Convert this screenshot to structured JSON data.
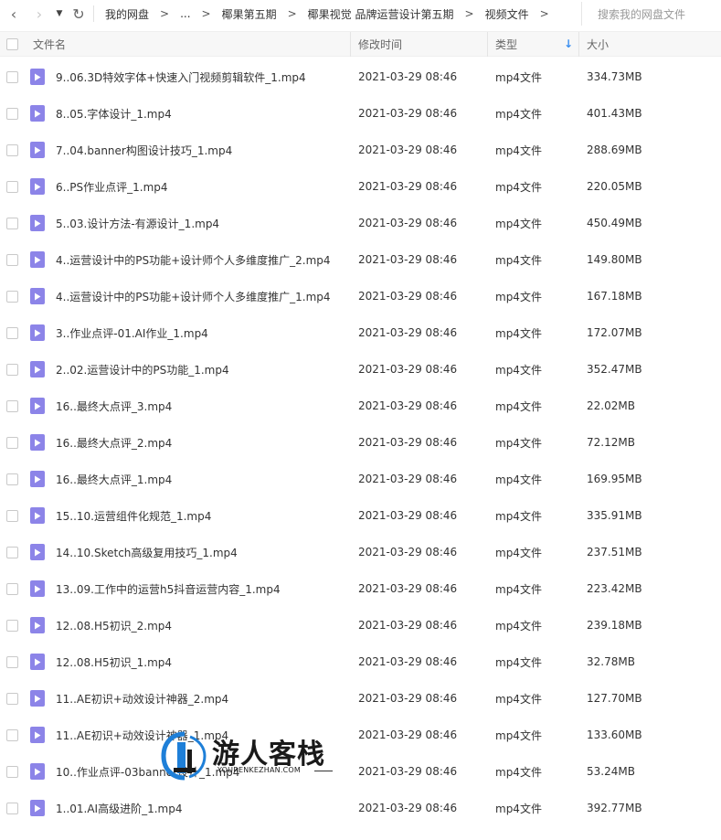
{
  "nav": {
    "back_icon": "chevron-left-icon",
    "forward_icon": "chevron-right-icon",
    "dropdown_icon": "caret-down-icon",
    "refresh_icon": "refresh-icon",
    "back_glyph": "‹",
    "forward_glyph": "›",
    "dropdown_glyph": "▼",
    "refresh_glyph": "↻"
  },
  "breadcrumb": {
    "items": [
      "我的网盘",
      "...",
      "椰果第五期",
      "椰果视觉 品牌运营设计第五期",
      "视频文件"
    ],
    "separator": ">"
  },
  "search": {
    "placeholder": "搜索我的网盘文件"
  },
  "columns": {
    "name": "文件名",
    "modified": "修改时间",
    "type": "类型",
    "size": "大小",
    "sort_indicator": "↓"
  },
  "files": [
    {
      "name": "9..06.3D特效字体+快速入门视频剪辑软件_1.mp4",
      "modified": "2021-03-29 08:46",
      "type": "mp4文件",
      "size": "334.73MB"
    },
    {
      "name": "8..05.字体设计_1.mp4",
      "modified": "2021-03-29 08:46",
      "type": "mp4文件",
      "size": "401.43MB"
    },
    {
      "name": "7..04.banner构图设计技巧_1.mp4",
      "modified": "2021-03-29 08:46",
      "type": "mp4文件",
      "size": "288.69MB"
    },
    {
      "name": "6..PS作业点评_1.mp4",
      "modified": "2021-03-29 08:46",
      "type": "mp4文件",
      "size": "220.05MB"
    },
    {
      "name": "5..03.设计方法-有源设计_1.mp4",
      "modified": "2021-03-29 08:46",
      "type": "mp4文件",
      "size": "450.49MB"
    },
    {
      "name": "4..运营设计中的PS功能+设计师个人多维度推广_2.mp4",
      "modified": "2021-03-29 08:46",
      "type": "mp4文件",
      "size": "149.80MB"
    },
    {
      "name": "4..运营设计中的PS功能+设计师个人多维度推广_1.mp4",
      "modified": "2021-03-29 08:46",
      "type": "mp4文件",
      "size": "167.18MB"
    },
    {
      "name": "3..作业点评-01.AI作业_1.mp4",
      "modified": "2021-03-29 08:46",
      "type": "mp4文件",
      "size": "172.07MB"
    },
    {
      "name": "2..02.运营设计中的PS功能_1.mp4",
      "modified": "2021-03-29 08:46",
      "type": "mp4文件",
      "size": "352.47MB"
    },
    {
      "name": "16..最终大点评_3.mp4",
      "modified": "2021-03-29 08:46",
      "type": "mp4文件",
      "size": "22.02MB"
    },
    {
      "name": "16..最终大点评_2.mp4",
      "modified": "2021-03-29 08:46",
      "type": "mp4文件",
      "size": "72.12MB"
    },
    {
      "name": "16..最终大点评_1.mp4",
      "modified": "2021-03-29 08:46",
      "type": "mp4文件",
      "size": "169.95MB"
    },
    {
      "name": "15..10.运营组件化规范_1.mp4",
      "modified": "2021-03-29 08:46",
      "type": "mp4文件",
      "size": "335.91MB"
    },
    {
      "name": "14..10.Sketch高级复用技巧_1.mp4",
      "modified": "2021-03-29 08:46",
      "type": "mp4文件",
      "size": "237.51MB"
    },
    {
      "name": "13..09.工作中的运营h5抖音运营内容_1.mp4",
      "modified": "2021-03-29 08:46",
      "type": "mp4文件",
      "size": "223.42MB"
    },
    {
      "name": "12..08.H5初识_2.mp4",
      "modified": "2021-03-29 08:46",
      "type": "mp4文件",
      "size": "239.18MB"
    },
    {
      "name": "12..08.H5初识_1.mp4",
      "modified": "2021-03-29 08:46",
      "type": "mp4文件",
      "size": "32.78MB"
    },
    {
      "name": "11..AE初识+动效设计神器_2.mp4",
      "modified": "2021-03-29 08:46",
      "type": "mp4文件",
      "size": "127.70MB"
    },
    {
      "name": "11..AE初识+动效设计神器_1.mp4",
      "modified": "2021-03-29 08:46",
      "type": "mp4文件",
      "size": "133.60MB"
    },
    {
      "name": "10..作业点评-03banner设计_1.mp4",
      "modified": "2021-03-29 08:46",
      "type": "mp4文件",
      "size": "53.24MB"
    },
    {
      "name": "1..01.AI高级进阶_1.mp4",
      "modified": "2021-03-29 08:46",
      "type": "mp4文件",
      "size": "392.77MB"
    }
  ],
  "file_icon": "video-file-icon",
  "watermark": {
    "text": "游人客栈",
    "url": "YOURENKEZHAN.COM",
    "logo_icon": "youren-logo-icon"
  },
  "colors": {
    "file_icon": "#8c84e8",
    "sort_accent": "#3b8ff0",
    "header_bg": "#f7f7f7",
    "watermark_blue": "#1e7fd8"
  }
}
